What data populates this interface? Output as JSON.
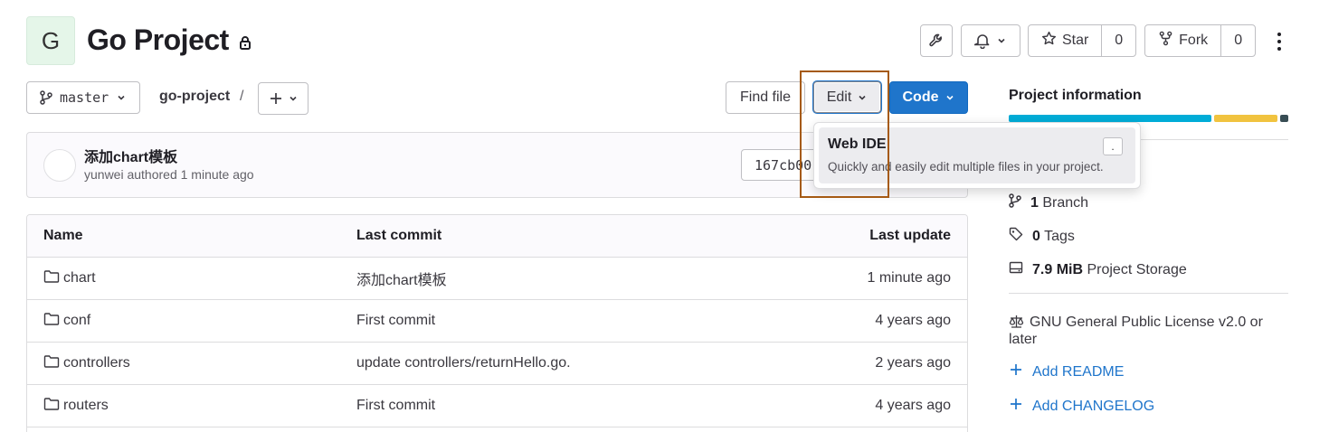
{
  "project": {
    "avatar_letter": "G",
    "title": "Go Project"
  },
  "header_actions": {
    "star_label": "Star",
    "star_count": "0",
    "fork_label": "Fork",
    "fork_count": "0"
  },
  "toolbar": {
    "branch": "master",
    "breadcrumb": "go-project",
    "separator": "/",
    "find_file": "Find file",
    "edit": "Edit",
    "code": "Code"
  },
  "edit_dropdown": {
    "item_title": "Web IDE",
    "item_description": "Quickly and easily edit multiple files in your project.",
    "shortcut": "."
  },
  "last_commit": {
    "message": "添加chart模板",
    "meta": "yunwei authored 1 minute ago",
    "sha": "167cb00"
  },
  "file_table": {
    "headers": [
      "Name",
      "Last commit",
      "Last update"
    ],
    "rows": [
      {
        "name": "chart",
        "commit": "添加chart模板",
        "updated": "1 minute ago"
      },
      {
        "name": "conf",
        "commit": "First commit",
        "updated": "4 years ago"
      },
      {
        "name": "controllers",
        "commit": "update controllers/returnHello.go.",
        "updated": "2 years ago"
      },
      {
        "name": "routers",
        "commit": "First commit",
        "updated": "4 years ago"
      }
    ]
  },
  "sidebar": {
    "title": "Project information",
    "languages": [
      {
        "color": "#00acd7"
      },
      {
        "color": "#f1c33f"
      },
      {
        "color": "#384d54"
      }
    ],
    "branches_count": "1",
    "branches_label": "Branch",
    "tags_count": "0",
    "tags_label": "Tags",
    "storage_size": "7.9 MiB",
    "storage_label": "Project Storage",
    "license": "GNU General Public License v2.0 or later",
    "add_readme": "Add README",
    "add_changelog": "Add CHANGELOG"
  }
}
